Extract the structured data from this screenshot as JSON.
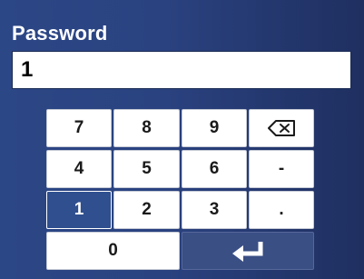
{
  "dialog": {
    "title": "Password",
    "value": "1"
  },
  "keypad": {
    "keys": {
      "k7": "7",
      "k8": "8",
      "k9": "9",
      "k4": "4",
      "k5": "5",
      "k6": "6",
      "minus": "-",
      "k1": "1",
      "k2": "2",
      "k3": "3",
      "dot": ".",
      "k0": "0"
    },
    "selected_key": "1",
    "backspace_icon": "backspace-icon",
    "enter_icon": "enter-return-icon"
  },
  "colors": {
    "background": "#2a4280",
    "key_bg": "#ffffff",
    "selected_key_bg": "#2f4f8f",
    "enter_key_bg": "#3a4f84"
  }
}
